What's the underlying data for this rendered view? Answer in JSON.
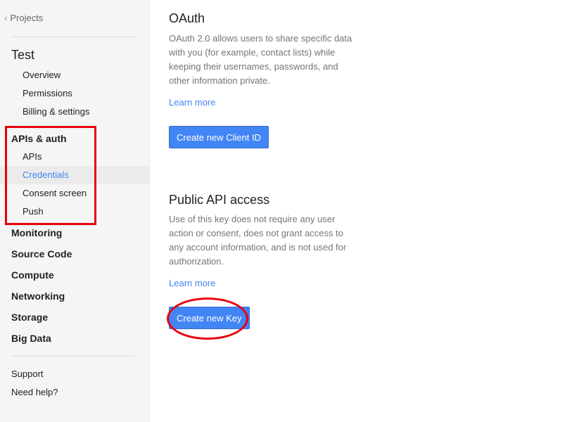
{
  "sidebar": {
    "back_label": "Projects",
    "project_title": "Test",
    "project_items": [
      "Overview",
      "Permissions",
      "Billing & settings"
    ],
    "apis_auth": {
      "label": "APIs & auth",
      "items": [
        "APIs",
        "Credentials",
        "Consent screen",
        "Push"
      ],
      "active_item": "Credentials"
    },
    "sections": [
      "Monitoring",
      "Source Code",
      "Compute",
      "Networking",
      "Storage",
      "Big Data"
    ],
    "footer": [
      "Support",
      "Need help?"
    ]
  },
  "oauth": {
    "title": "OAuth",
    "description": "OAuth 2.0 allows users to share specific data with you (for example, contact lists) while keeping their usernames, passwords, and other information private.",
    "learn_more": "Learn more",
    "button": "Create new Client ID"
  },
  "public_api": {
    "title": "Public API access",
    "description": "Use of this key does not require any user action or consent, does not grant access to any account information, and is not used for authorization.",
    "learn_more": "Learn more",
    "button": "Create new Key"
  },
  "colors": {
    "accent": "#4285f4",
    "annotation": "#e8000b",
    "sidebar_bg": "#f5f5f5"
  }
}
